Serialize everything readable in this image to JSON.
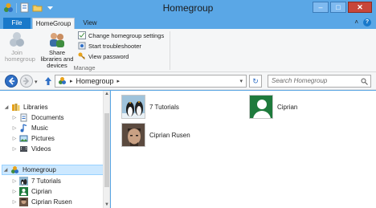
{
  "window": {
    "title": "Homegroup",
    "buttons": {
      "minimize": "–",
      "maximize": "□",
      "close": "✕"
    }
  },
  "ribbon": {
    "tabs": [
      "File",
      "HomeGroup",
      "View"
    ],
    "expand_glyph": "˄",
    "help_glyph": "?",
    "join": "Join homegroup",
    "share": "Share libraries and devices",
    "change_settings": "Change homegroup settings",
    "troubleshooter": "Start troubleshooter",
    "view_password": "View password",
    "group_label": "Manage"
  },
  "address": {
    "current": "Homegroup",
    "search_placeholder": "Search Homegroup"
  },
  "nav_tree": {
    "libraries": "Libraries",
    "documents": "Documents",
    "music": "Music",
    "pictures": "Pictures",
    "videos": "Videos",
    "homegroup": "Homegroup",
    "tutorials": "7 Tutorials",
    "ciprian": "Ciprian",
    "ciprian_rusen": "Ciprian Rusen"
  },
  "content_items": [
    "7 Tutorials",
    "Ciprian",
    "Ciprian Rusen"
  ],
  "colors": {
    "title_bar": "#5aa7e6",
    "file_tab": "#1979ca",
    "selection": "#cce8ff",
    "avatar_green": "#1e7a3c"
  }
}
